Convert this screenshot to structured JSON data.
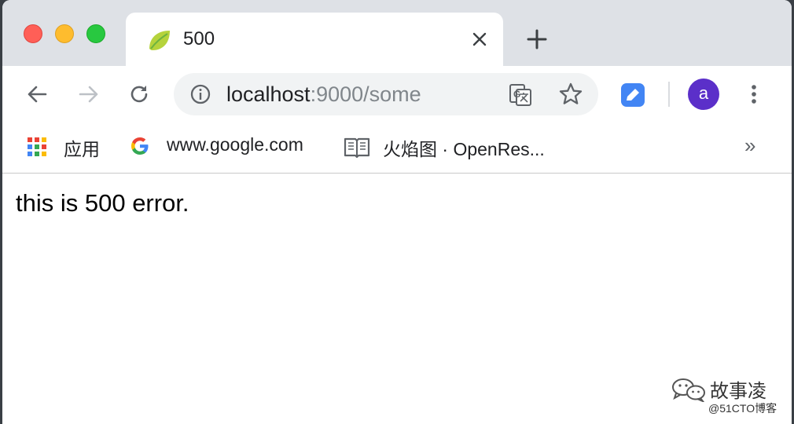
{
  "window": {
    "tab": {
      "title": "500"
    }
  },
  "toolbar": {
    "url_host": "localhost",
    "url_rest": ":9000/some",
    "avatar_letter": "a"
  },
  "bookmarks": {
    "items": [
      {
        "label": "应用",
        "icon": "apps-grid-icon"
      },
      {
        "label": "www.google.com",
        "icon": "google-icon"
      },
      {
        "label": "火焰图 · OpenRes...",
        "icon": "book-icon"
      }
    ],
    "more": "»"
  },
  "page": {
    "text": "this is 500 error."
  },
  "watermark": {
    "name": "故事凌",
    "sub": "@51CTO博客"
  },
  "colors": {
    "tabstrip": "#dee1e6",
    "omnibox": "#f1f3f4",
    "avatar": "#5b2fc9",
    "spring_green": "#6db33f"
  }
}
